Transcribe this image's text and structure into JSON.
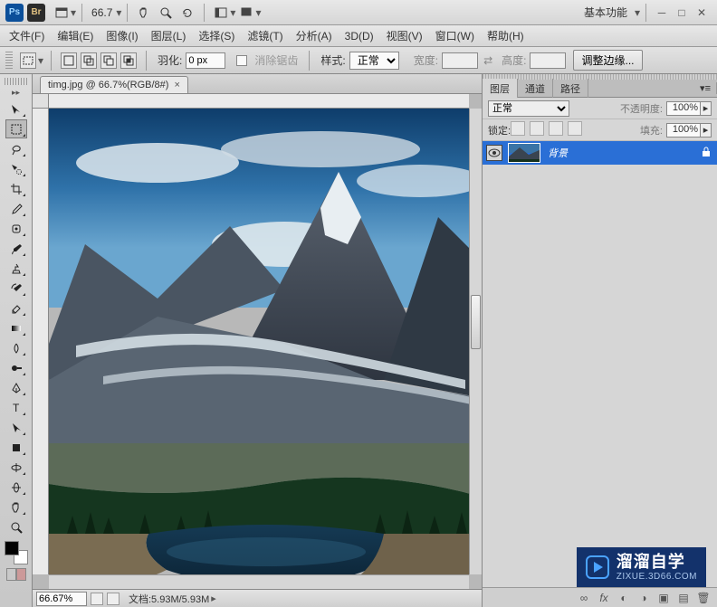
{
  "app_bar": {
    "ps_text": "Ps",
    "br_text": "Br",
    "zoom_level": "66.7",
    "workspace_label": "基本功能"
  },
  "main_menu": {
    "items": [
      "文件(F)",
      "编辑(E)",
      "图像(I)",
      "图层(L)",
      "选择(S)",
      "滤镜(T)",
      "分析(A)",
      "3D(D)",
      "视图(V)",
      "窗口(W)",
      "帮助(H)"
    ]
  },
  "options_bar": {
    "feather_label": "羽化:",
    "feather_value": "0 px",
    "antialias_label": "消除锯齿",
    "style_label": "样式:",
    "style_value": "正常",
    "width_label": "宽度:",
    "height_label": "高度:",
    "refine_edge": "调整边缘..."
  },
  "document": {
    "tab_label": "timg.jpg @ 66.7%(RGB/8#)",
    "status_zoom": "66.67%",
    "doc_info": "文档:5.93M/5.93M"
  },
  "panels": {
    "tabs": [
      "图层",
      "通道",
      "路径"
    ],
    "blend_mode": "正常",
    "opacity_label": "不透明度:",
    "opacity_value": "100%",
    "lock_label": "锁定:",
    "fill_label": "填充:",
    "fill_value": "100%",
    "layer_name": "背景"
  },
  "watermark": {
    "line1": "溜溜自学",
    "line2": "ZIXUE.3D66.COM"
  }
}
